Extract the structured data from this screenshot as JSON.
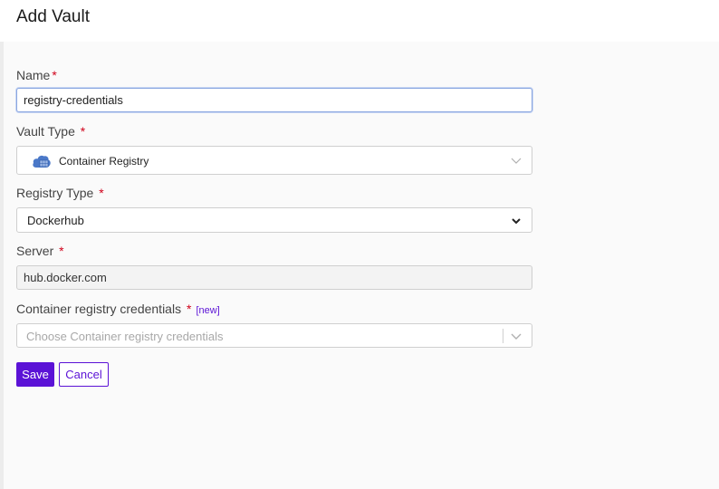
{
  "header": {
    "title": "Add Vault"
  },
  "form": {
    "name": {
      "label": "Name",
      "required_mark": "*",
      "value": "registry-credentials"
    },
    "vault_type": {
      "label": "Vault Type",
      "required_mark": "*",
      "selected": "Container Registry",
      "icon": "container-registry-cloud-icon"
    },
    "registry_type": {
      "label": "Registry Type",
      "required_mark": "*",
      "selected": "Dockerhub"
    },
    "server": {
      "label": "Server",
      "required_mark": "*",
      "value": "hub.docker.com"
    },
    "credentials": {
      "label": "Container registry credentials",
      "required_mark": "*",
      "new_link": "[new]",
      "placeholder": "Choose Container registry credentials"
    }
  },
  "actions": {
    "save_label": "Save",
    "cancel_label": "Cancel"
  },
  "colors": {
    "accent": "#5b12d6",
    "required": "#d0021b",
    "focus_border": "#8aa6e0"
  }
}
